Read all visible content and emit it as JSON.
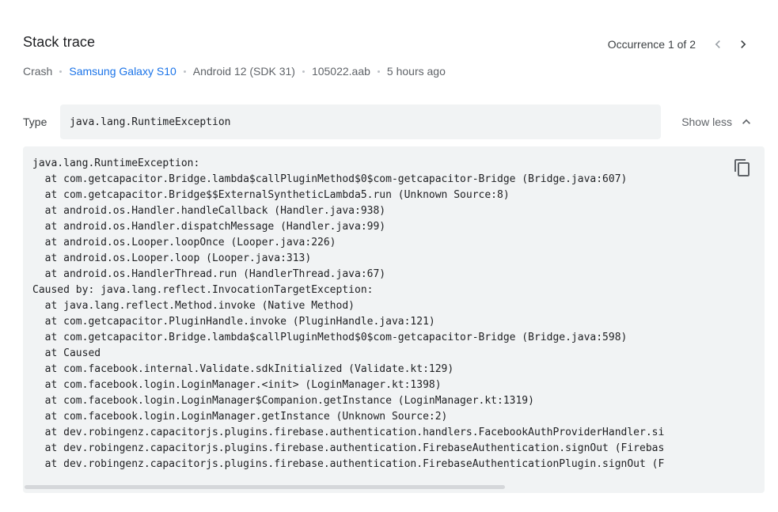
{
  "header": {
    "title": "Stack trace",
    "occurrence_label": "Occurrence 1 of 2",
    "prev_icon": "chevron-left-icon",
    "next_icon": "chevron-right-icon"
  },
  "meta": {
    "type": "Crash",
    "device": "Samsung Galaxy S10",
    "os": "Android 12 (SDK 31)",
    "build": "105022.aab",
    "time": "5 hours ago"
  },
  "type_row": {
    "label": "Type",
    "value": "java.lang.RuntimeException",
    "toggle_label": "Show less",
    "toggle_icon": "chevron-up-icon"
  },
  "trace": {
    "copy_icon": "copy-icon",
    "lines": [
      "java.lang.RuntimeException:",
      "  at com.getcapacitor.Bridge.lambda$callPluginMethod$0$com-getcapacitor-Bridge (Bridge.java:607)",
      "  at com.getcapacitor.Bridge$$ExternalSyntheticLambda5.run (Unknown Source:8)",
      "  at android.os.Handler.handleCallback (Handler.java:938)",
      "  at android.os.Handler.dispatchMessage (Handler.java:99)",
      "  at android.os.Looper.loopOnce (Looper.java:226)",
      "  at android.os.Looper.loop (Looper.java:313)",
      "  at android.os.HandlerThread.run (HandlerThread.java:67)",
      "Caused by: java.lang.reflect.InvocationTargetException:",
      "  at java.lang.reflect.Method.invoke (Native Method)",
      "  at com.getcapacitor.PluginHandle.invoke (PluginHandle.java:121)",
      "  at com.getcapacitor.Bridge.lambda$callPluginMethod$0$com-getcapacitor-Bridge (Bridge.java:598)",
      "  at Caused",
      "  at com.facebook.internal.Validate.sdkInitialized (Validate.kt:129)",
      "  at com.facebook.login.LoginManager.<init> (LoginManager.kt:1398)",
      "  at com.facebook.login.LoginManager$Companion.getInstance (LoginManager.kt:1319)",
      "  at com.facebook.login.LoginManager.getInstance (Unknown Source:2)",
      "  at dev.robingenz.capacitorjs.plugins.firebase.authentication.handlers.FacebookAuthProviderHandler.si",
      "  at dev.robingenz.capacitorjs.plugins.firebase.authentication.FirebaseAuthentication.signOut (Firebas",
      "  at dev.robingenz.capacitorjs.plugins.firebase.authentication.FirebaseAuthenticationPlugin.signOut (F"
    ]
  },
  "colors": {
    "accent": "#1a73e8",
    "surface": "#f1f3f4",
    "text": "#202124",
    "muted": "#5f6368"
  }
}
